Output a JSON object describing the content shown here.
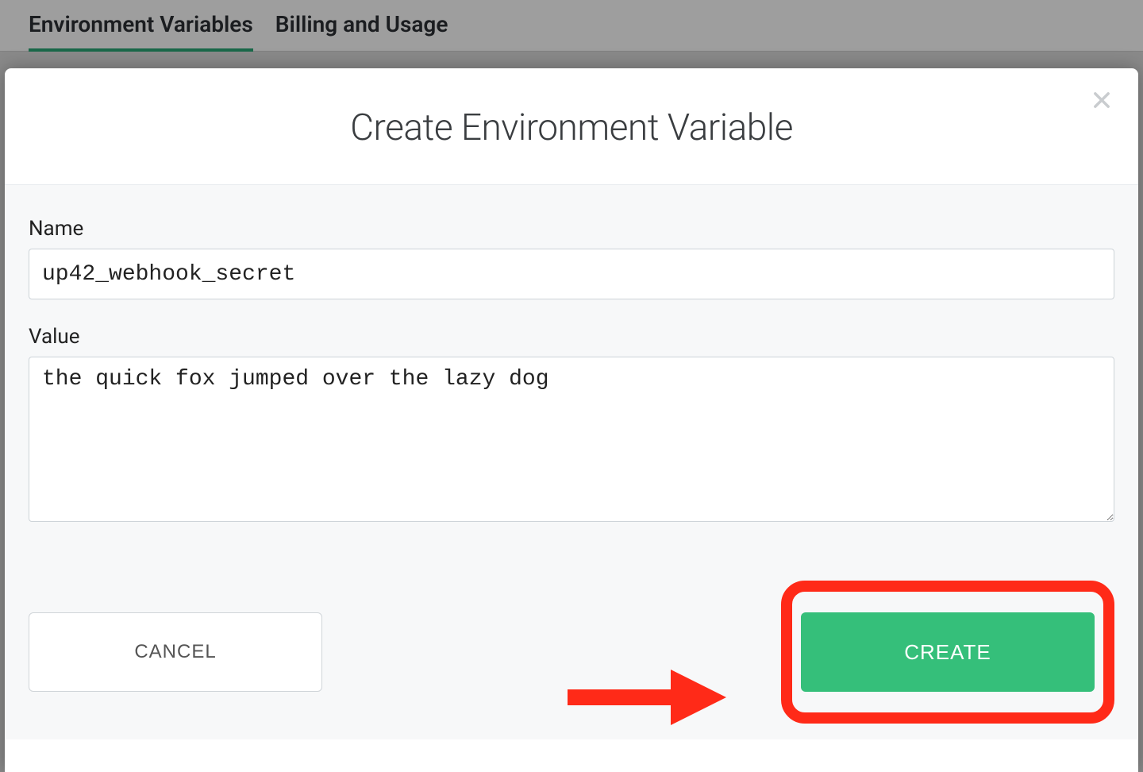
{
  "tabs": {
    "env_vars": "Environment Variables",
    "billing": "Billing and Usage"
  },
  "modal": {
    "title": "Create Environment Variable",
    "name_label": "Name",
    "name_value": "up42_webhook_secret",
    "value_label": "Value",
    "value_value": "the quick fox jumped over the lazy dog",
    "cancel_label": "CANCEL",
    "create_label": "CREATE"
  },
  "colors": {
    "accent_green": "#35bf7a",
    "tab_underline": "#2aa876",
    "annotation_red": "#ff2a18"
  }
}
